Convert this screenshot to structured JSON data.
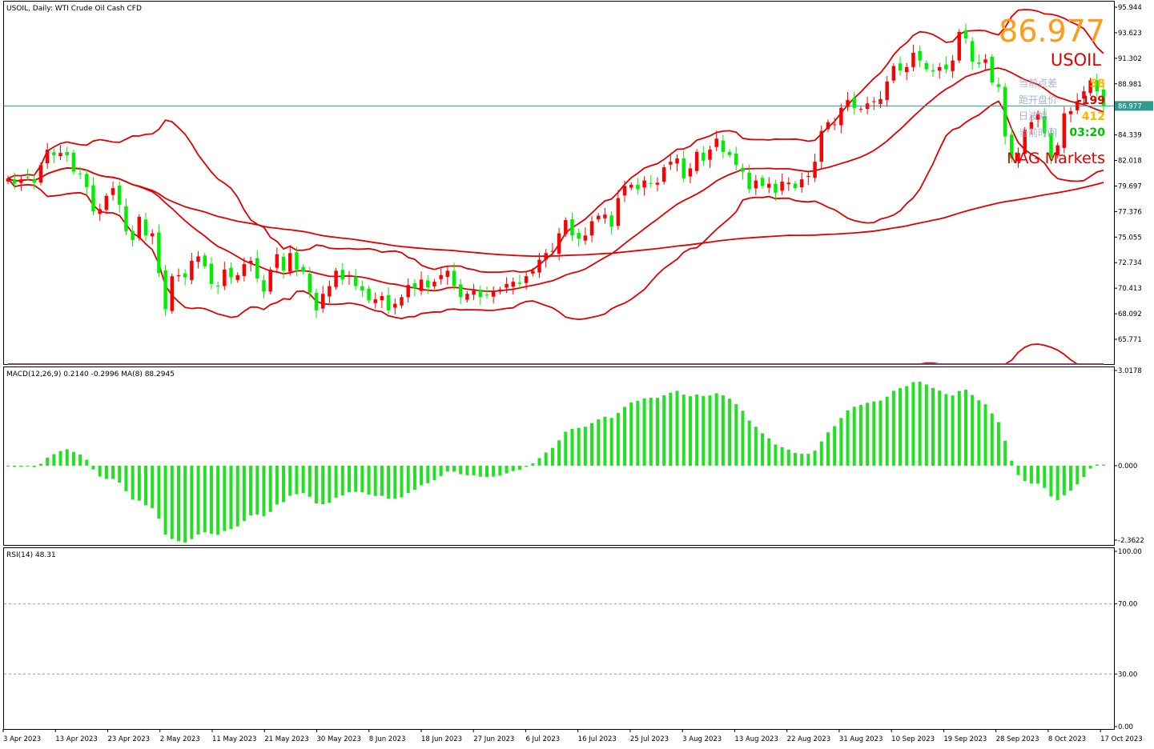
{
  "header": {
    "title": "USOIL, Daily:  WTI Crude Oil Cash CFD",
    "macd_label": "MACD(12,26,9) 0.2140 -0.2996 MA(8) 88.2945",
    "rsi_label": "RSI(14) 48.31"
  },
  "overlay": {
    "price": "86.977",
    "symbol": "USOIL",
    "spread_label": "当前点差",
    "spread_value": "58",
    "open_label": "距开盘价",
    "open_value": "-199",
    "daily_label": "日波幅",
    "daily_value": "412",
    "time_label": "当前时间",
    "time_value": "03:20",
    "brand": "NAG Markets"
  },
  "colors": {
    "bull": "#ff0000",
    "bear": "#00ee00",
    "bands": "#e00000",
    "price_line": "#2f9a8f",
    "rsi": "#2b7fd6",
    "price_big": "#ff9a1a",
    "symbol": "#e00000",
    "spread_value": "#ffb400",
    "open_value": "#e00000",
    "daily_value": "#ffb400",
    "time_value": "#00c000",
    "brand": "#e00000",
    "overlay_label": "#9aa6c8",
    "current_price_tag": "#2f9a8f"
  },
  "chart_data": {
    "type": "candlestick",
    "symbol": "USOIL",
    "timeframe": "Daily",
    "current_price": 86.977,
    "price_axis_ticks": [
      "95.944",
      "93.623",
      "91.302",
      "88.981",
      "86.977",
      "84.339",
      "82.018",
      "79.697",
      "77.376",
      "75.055",
      "72.734",
      "70.413",
      "68.092",
      "65.771"
    ],
    "price_ylim": [
      64.9,
      96.2
    ],
    "macd_axis_ticks": [
      "3.0178",
      "0.000",
      "-2.3622"
    ],
    "macd_ylim": [
      -2.55,
      3.2
    ],
    "rsi_axis_ticks": [
      "100.00",
      "70.00",
      "30.00",
      "0.00"
    ],
    "rsi_levels": [
      70,
      30
    ],
    "rsi_ylim": [
      0,
      100
    ],
    "x_tick_labels": [
      "3 Apr 2023",
      "13 Apr 2023",
      "23 Apr 2023",
      "2 May 2023",
      "11 May 2023",
      "21 May 2023",
      "30 May 2023",
      "8 Jun 2023",
      "18 Jun 2023",
      "27 Jun 2023",
      "6 Jul 2023",
      "16 Jul 2023",
      "25 Jul 2023",
      "3 Aug 2023",
      "13 Aug 2023",
      "22 Aug 2023",
      "31 Aug 2023",
      "10 Sep 2023",
      "19 Sep 2023",
      "28 Sep 2023",
      "8 Oct 2023",
      "17 Oct 2023"
    ],
    "closes": [
      80.4,
      79.9,
      80.3,
      80.5,
      80.0,
      81.6,
      83.0,
      82.5,
      82.7,
      82.5,
      81.0,
      80.8,
      79.6,
      77.4,
      77.6,
      78.8,
      79.5,
      78.0,
      75.6,
      74.8,
      76.9,
      75.2,
      75.4,
      71.8,
      68.5,
      71.5,
      71.6,
      71.4,
      72.9,
      73.3,
      72.4,
      70.8,
      70.6,
      72.1,
      71.4,
      71.6,
      72.6,
      72.9,
      71.3,
      70.1,
      72.1,
      73.5,
      72.0,
      73.6,
      72.1,
      71.9,
      70.0,
      68.4,
      69.9,
      70.6,
      72.0,
      71.2,
      71.6,
      70.6,
      70.2,
      69.3,
      69.4,
      69.7,
      68.4,
      69.0,
      69.6,
      70.7,
      70.4,
      71.2,
      70.5,
      71.0,
      71.6,
      72.0,
      70.6,
      69.6,
      69.9,
      70.2,
      69.6,
      69.8,
      70.1,
      70.3,
      70.8,
      71.0,
      70.8,
      71.5,
      72.0,
      73.0,
      73.6,
      73.8,
      75.4,
      76.6,
      75.2,
      74.9,
      75.2,
      76.5,
      77.0,
      77.1,
      76.0,
      78.6,
      79.7,
      79.8,
      79.4,
      80.2,
      79.9,
      80.0,
      81.4,
      81.9,
      82.2,
      80.4,
      81.3,
      82.8,
      82.0,
      83.0,
      84.0,
      82.8,
      82.5,
      81.6,
      81.0,
      79.4,
      80.2,
      79.7,
      79.9,
      79.1,
      80.1,
      80.0,
      79.5,
      80.3,
      80.6,
      81.9,
      84.7,
      85.5,
      85.3,
      86.8,
      87.5,
      86.8,
      86.7,
      87.2,
      87.4,
      87.6,
      89.2,
      90.6,
      90.2,
      90.5,
      91.8,
      91.1,
      90.3,
      90.1,
      90.5,
      90.3,
      91.1,
      93.7,
      93.1,
      91.0,
      90.8,
      91.2,
      89.1,
      88.7,
      84.2,
      82.2,
      82.7,
      84.8,
      85.5,
      86.2,
      84.5,
      82.3,
      83.4,
      86.3,
      86.5,
      87.4,
      88.3,
      89.3,
      88.3,
      86.98
    ],
    "x_range": [
      "2023-03-31",
      "2023-10-20"
    ]
  }
}
